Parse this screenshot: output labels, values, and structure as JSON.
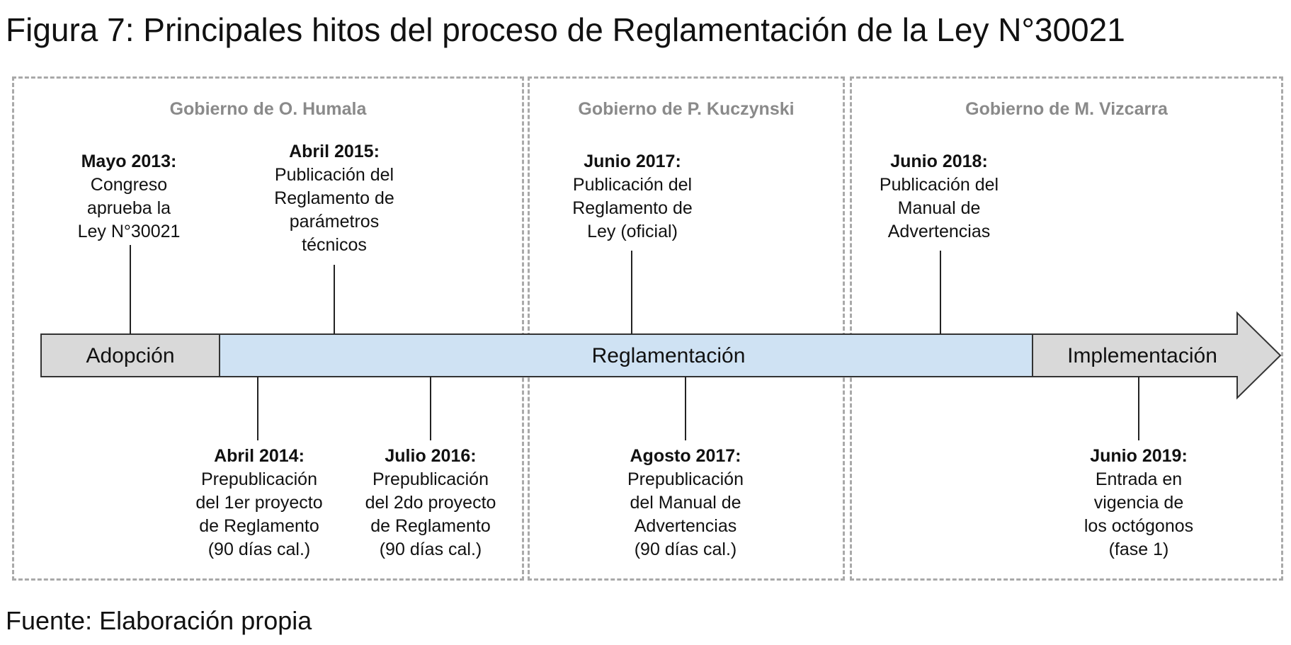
{
  "title": "Figura 7: Principales hitos del proceso de Reglamentación de la Ley N°30021",
  "source": "Fuente: Elaboración propia",
  "governments": [
    "Gobierno de O. Humala",
    "Gobierno de P. Kuczynski",
    "Gobierno de M. Vizcarra"
  ],
  "phases": {
    "adopcion": "Adopción",
    "reglamentacion": "Reglamentación",
    "implementacion": "Implementación"
  },
  "milestones_top": [
    {
      "date": "Mayo 2013:",
      "desc": "Congreso\naprueba la\nLey N°30021"
    },
    {
      "date": "Abril 2015:",
      "desc": "Publicación del\nReglamento de\nparámetros\ntécnicos"
    },
    {
      "date": "Junio 2017:",
      "desc": "Publicación del\nReglamento de\nLey (oficial)"
    },
    {
      "date": "Junio 2018:",
      "desc": "Publicación del\nManual de\nAdvertencias"
    }
  ],
  "milestones_bottom": [
    {
      "date": "Abril 2014:",
      "desc": "Prepublicación\ndel 1er proyecto\nde Reglamento\n(90 días cal.)"
    },
    {
      "date": "Julio 2016:",
      "desc": "Prepublicación\ndel 2do proyecto\nde Reglamento\n(90 días cal.)"
    },
    {
      "date": "Agosto 2017:",
      "desc": "Prepublicación\ndel Manual de\nAdvertencias\n(90 días cal.)"
    },
    {
      "date": "Junio 2019:",
      "desc": "Entrada en\nvigencia de\nlos octógonos\n(fase 1)"
    }
  ],
  "colors": {
    "adopcion_fill": "#d9d9d9",
    "reglamentacion_fill": "#cfe2f3",
    "implementacion_fill": "#d9d9d9",
    "panel_border": "#a9a9a9",
    "government_text": "#8a8a8a"
  }
}
